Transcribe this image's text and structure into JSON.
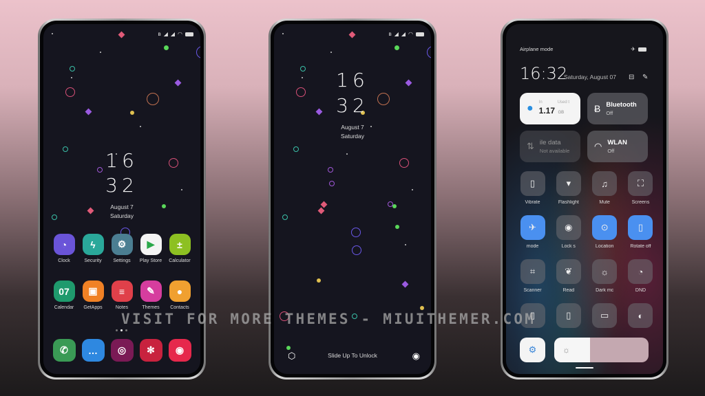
{
  "status_bar": {
    "icons": [
      "bluetooth-icon",
      "signal-icon",
      "signal-icon",
      "wifi-icon",
      "battery-icon"
    ]
  },
  "home_screen": {
    "clock": {
      "hour": "16",
      "minute": "32"
    },
    "date": "August 7",
    "weekday": "Saturday",
    "apps_row1": [
      {
        "label": "Clock",
        "icon": "clock-icon",
        "color": "#6a54d8",
        "glyph": "◔"
      },
      {
        "label": "Security",
        "icon": "lightning-icon",
        "color": "#2aa89a",
        "glyph": "ϟ"
      },
      {
        "label": "Settings",
        "icon": "gear-icon",
        "color": "#4b7e92",
        "glyph": "⚙"
      },
      {
        "label": "Play Store",
        "icon": "play-icon",
        "color": "#f4f4f4",
        "glyph": "▶"
      },
      {
        "label": "Calculator",
        "icon": "calculator-icon",
        "color": "#8dc022",
        "glyph": "±"
      }
    ],
    "apps_row2": [
      {
        "label": "Calendar",
        "icon": "calendar-icon",
        "color": "#1f9a6d",
        "glyph": "07"
      },
      {
        "label": "GetApps",
        "icon": "shopping-bag-icon",
        "color": "#f08125",
        "glyph": "▣"
      },
      {
        "label": "Notes",
        "icon": "notes-icon",
        "color": "#e0404a",
        "glyph": "≡"
      },
      {
        "label": "Themes",
        "icon": "paintbrush-icon",
        "color": "#d63d9e",
        "glyph": "✎"
      },
      {
        "label": "Contacts",
        "icon": "contact-icon",
        "color": "#f0a030",
        "glyph": "●"
      }
    ],
    "dock": [
      {
        "name": "phone",
        "icon": "phone-icon",
        "color": "#3a9a55",
        "glyph": "✆"
      },
      {
        "name": "messages",
        "icon": "message-icon",
        "color": "#2e88e0",
        "glyph": "…"
      },
      {
        "name": "fingerprint",
        "icon": "fingerprint-icon",
        "color": "#7a1a55",
        "glyph": "◎"
      },
      {
        "name": "gallery",
        "icon": "flower-icon",
        "color": "#c8223e",
        "glyph": "✻"
      },
      {
        "name": "camera",
        "icon": "camera-icon",
        "color": "#e6284c",
        "glyph": "◉"
      }
    ],
    "page_indicator": {
      "pages": 3,
      "current": 2
    }
  },
  "lock_screen": {
    "clock": {
      "hour": "16",
      "minute": "32"
    },
    "date": "August 7",
    "weekday": "Saturday",
    "unlock_hint": "Slide Up To Unlock"
  },
  "control_center": {
    "top_label": "Airplane mode",
    "time": "16:32",
    "date": "Saturday, August 07",
    "data_tile": {
      "label_left": "In",
      "label_right": "Used t",
      "value": "1.17",
      "unit": "GB"
    },
    "bluetooth_tile": {
      "title": "Bluetooth",
      "state": "Off"
    },
    "mobile_data_tile": {
      "title": "ile data",
      "state": "Not available"
    },
    "wlan_tile": {
      "title": "WLAN",
      "state": "Off"
    },
    "toggles_row1": [
      {
        "label": "Vibrate",
        "icon": "vibrate-icon",
        "glyph": "▯",
        "on": false
      },
      {
        "label": "Flashlight",
        "icon": "flashlight-icon",
        "glyph": "▾",
        "on": false
      },
      {
        "label": "Mute",
        "icon": "bell-icon",
        "glyph": "♫",
        "on": false
      },
      {
        "label": "Screens",
        "icon": "screenshot-icon",
        "glyph": "⛶",
        "on": false
      }
    ],
    "toggles_row2": [
      {
        "label": "mode",
        "icon": "airplane-icon",
        "glyph": "✈",
        "on": true
      },
      {
        "label": "Lock s",
        "icon": "lock-screen-icon",
        "glyph": "◉",
        "on": false
      },
      {
        "label": "Location",
        "icon": "location-icon",
        "glyph": "⊙",
        "on": true
      },
      {
        "label": "Rotate off",
        "icon": "rotate-icon",
        "glyph": "▯",
        "on": true
      }
    ],
    "toggles_row3": [
      {
        "label": "Scanner",
        "icon": "scanner-icon",
        "glyph": "⌗",
        "on": false
      },
      {
        "label": "Read",
        "icon": "leaf-icon",
        "glyph": "❦",
        "on": false
      },
      {
        "label": "Dark mc",
        "icon": "sunset-icon",
        "glyph": "☼",
        "on": false
      },
      {
        "label": "DND",
        "icon": "moon-icon",
        "glyph": "◔",
        "on": false
      }
    ],
    "toggles_row4": [
      {
        "label": "",
        "icon": "battery-saver-icon",
        "glyph": "▯",
        "on": false
      },
      {
        "label": "",
        "icon": "ultra-battery-icon",
        "glyph": "▯",
        "on": false
      },
      {
        "label": "",
        "icon": "cast-icon",
        "glyph": "▭",
        "on": false
      },
      {
        "label": "",
        "icon": "reading-icon",
        "glyph": "◐",
        "on": false
      }
    ],
    "brightness": {
      "auto": true,
      "level_percent": 38
    }
  },
  "watermark": "VISIT FOR MORE THEMES - MIUITHEMER.COM"
}
